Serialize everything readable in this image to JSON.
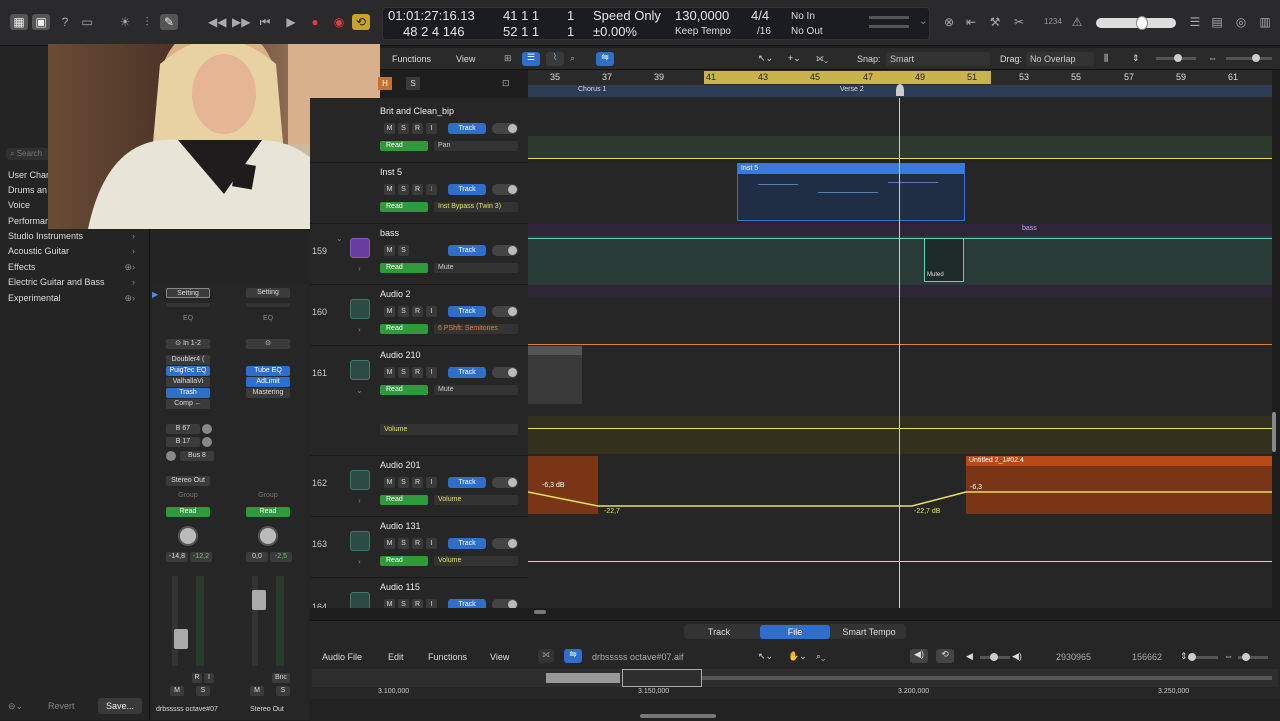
{
  "lcd": {
    "timecode": "01:01:27:16.13",
    "bars_top": "41  1  1",
    "bars_top_sub": "1",
    "bars_bottom": "48  2  4  146",
    "bars_bottom2": "52  1  1",
    "bars_bottom2_sub": "1",
    "mode": "Speed Only",
    "tempo": "130,0000",
    "pitch": "±0.00%",
    "keep_tempo": "Keep Tempo",
    "signature": "4/4",
    "division": "/16",
    "in": "No In",
    "out": "No Out"
  },
  "topbar_right": {
    "counter": "1234"
  },
  "browser": {
    "search_placeholder": "Search",
    "items": [
      {
        "label": "User Char",
        "icon": ""
      },
      {
        "label": "Drums an",
        "icon": ""
      },
      {
        "label": "Voice",
        "icon": ""
      },
      {
        "label": "Performar",
        "icon": ""
      },
      {
        "label": "Studio Instruments",
        "icon": "chevron-right"
      },
      {
        "label": "Acoustic Guitar",
        "icon": "chevron-right"
      },
      {
        "label": "Effects",
        "icon": "plus-chevron"
      },
      {
        "label": "Electric Guitar and Bass",
        "icon": "chevron-right"
      },
      {
        "label": "Experimental",
        "icon": "plus-chevron"
      }
    ],
    "revert": "Revert",
    "save": "Save..."
  },
  "arrange_toolbar": {
    "functions": "Functions",
    "view": "View",
    "snap_label": "Snap:",
    "snap_value": "Smart",
    "drag_label": "Drag:",
    "drag_value": "No Overlap"
  },
  "ruler": {
    "bars": [
      "35",
      "37",
      "39",
      "41",
      "43",
      "45",
      "47",
      "49",
      "51",
      "53",
      "55",
      "57",
      "59",
      "61"
    ],
    "markers": [
      {
        "label": "Chorus 1"
      },
      {
        "label": "Verse 2"
      }
    ]
  },
  "tracks": [
    {
      "num": "",
      "name": "Brit and Clean_bip",
      "auto": "Pan",
      "mode": "Read",
      "track_label": "Track"
    },
    {
      "num": "",
      "name": "Inst 5",
      "auto": "Inst Bypass (Twin 3)",
      "mode": "Read",
      "track_label": "Track"
    },
    {
      "num": "159",
      "name": "bass",
      "auto": "Mute",
      "mode": "Read",
      "track_label": "Track"
    },
    {
      "num": "160",
      "name": "Audio 2",
      "auto": "6 PShft: Semitones",
      "mode": "Read",
      "track_label": "Track"
    },
    {
      "num": "161",
      "name": "Audio 210",
      "auto": "Mute",
      "mode": "Read",
      "track_label": "Track",
      "sub_lane": "Volume"
    },
    {
      "num": "162",
      "name": "Audio 201",
      "auto": "Volume",
      "mode": "Read",
      "track_label": "Track"
    },
    {
      "num": "163",
      "name": "Audio 131",
      "auto": "Volume",
      "mode": "Read",
      "track_label": "Track"
    },
    {
      "num": "164",
      "name": "Audio 115",
      "auto": "",
      "mode": "",
      "track_label": "Track"
    }
  ],
  "regions": {
    "inst5": "Inst 5",
    "bass": "bass",
    "muted": "Muted",
    "untitled": "Untitled 2_1#02.4",
    "db1": "-6,3 dB",
    "db2": "-22,7",
    "db3": "-22,7 dB",
    "db4": "-6,3"
  },
  "mixer": {
    "strip1": {
      "setting": "Setting",
      "eq": "EQ",
      "input": "In 1-2",
      "plugins": [
        "Doubler4 (",
        "PuigTec EQ",
        "ValhallaVi",
        "Trash",
        "Comp ←"
      ],
      "sends": [
        "B 67",
        "B 17",
        "Bus 8"
      ],
      "output": "Stereo Out",
      "group": "Group",
      "auto": "Read",
      "vol": "-14,8",
      "peak": "-12,2",
      "name": "drbsssss octave#07"
    },
    "strip2": {
      "setting": "Setting",
      "eq": "EQ",
      "plugins": [
        "Tube EQ",
        "AdLimit",
        "Mastering"
      ],
      "group": "Group",
      "auto": "Read",
      "vol": "0,0",
      "peak": "-2,5",
      "name": "Stereo Out",
      "bnc": "Bnc"
    }
  },
  "editor": {
    "tabs": [
      "Track",
      "File",
      "Smart Tempo"
    ],
    "active_tab": "File",
    "menus": [
      "Audio File",
      "Edit",
      "Functions",
      "View"
    ],
    "filename": "drbsssss octave#07.aif",
    "pos1": "2930965",
    "pos2": "156662",
    "ruler": [
      "3.100,000",
      "3.150,000",
      "3.200,000",
      "3.250,000"
    ]
  },
  "colors": {
    "accent_blue": "#2f6fcb",
    "read_green": "#2e9a3b",
    "automation_yellow": "#e8e060",
    "region_orange": "#b84a18",
    "cycle_yellow": "#c9b44a"
  }
}
